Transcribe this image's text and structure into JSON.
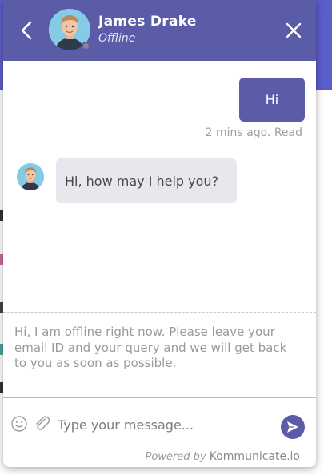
{
  "header": {
    "agent_name": "James Drake",
    "agent_status": "Offline",
    "back_icon": "chevron-left-icon",
    "close_icon": "close-icon"
  },
  "messages": [
    {
      "direction": "outgoing",
      "text": "Hi",
      "meta": "2 mins ago. Read"
    },
    {
      "direction": "incoming",
      "text": "Hi, how may I help you?"
    }
  ],
  "offline_note": "Hi, I am offline right now. Please leave your email ID and your query and we will get back to you as soon as possible.",
  "composer": {
    "placeholder": "Type your message...",
    "emoji_icon": "smiley-icon",
    "attach_icon": "paperclip-icon",
    "send_icon": "send-icon"
  },
  "footer": {
    "powered_prefix": "Powered by",
    "brand": "Kommunicate.io"
  },
  "colors": {
    "header_bg": "#5a5ca8",
    "page_accent": "#5a5ec9",
    "incoming_bubble": "#e7e7ee",
    "status_offline": "#8a8a8a"
  }
}
